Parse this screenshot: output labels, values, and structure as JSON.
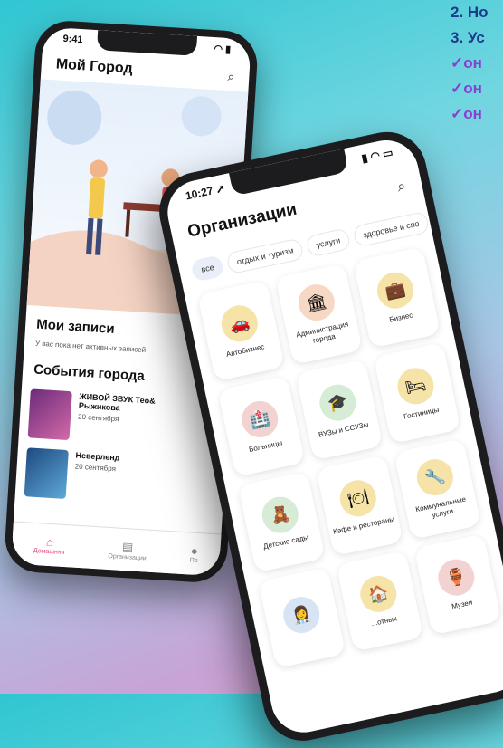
{
  "bullets": {
    "lines": [
      "2. Но",
      "3. Ус",
      "✓он",
      "✓он",
      "✓он"
    ]
  },
  "phone_back": {
    "time": "9:41",
    "title": "Мой Город",
    "records_title": "Мои записи",
    "records_empty": "У вас пока нет активных записей",
    "events_title": "События города",
    "events": [
      {
        "title": "ЖИВОЙ ЗВУК Тео& Рыжикова",
        "date": "20 сентября",
        "thumb": "#6b2b7a"
      },
      {
        "title": "Неверленд",
        "date": "20 сентября",
        "thumb": "#2a6aa8"
      }
    ],
    "tabs": [
      {
        "label": "Домашняя",
        "icon": "home-icon",
        "glyph": "⌂"
      },
      {
        "label": "Организации",
        "icon": "organizations-icon",
        "glyph": "▤"
      },
      {
        "label": "Пр",
        "icon": "profile-icon",
        "glyph": "●"
      }
    ]
  },
  "phone_front": {
    "time": "10:27",
    "title": "Организации",
    "chips": [
      "все",
      "отдых и туризм",
      "услуги",
      "здоровье и спо"
    ],
    "categories": [
      {
        "label": "Автобизнес",
        "icon": "car-icon",
        "glyph": "🚗",
        "color": "#f6e3a8"
      },
      {
        "label": "Администрация города",
        "icon": "city-hall-icon",
        "glyph": "🏛",
        "color": "#f7d8c4"
      },
      {
        "label": "Бизнес",
        "icon": "briefcase-icon",
        "glyph": "💼",
        "color": "#f6e3a8"
      },
      {
        "label": "Больницы",
        "icon": "hospital-icon",
        "glyph": "🏥",
        "color": "#f3d2d2"
      },
      {
        "label": "ВУЗы и ССУЗы",
        "icon": "education-icon",
        "glyph": "🎓",
        "color": "#d6ecd6"
      },
      {
        "label": "Гостиницы",
        "icon": "hotel-icon",
        "glyph": "🛏",
        "color": "#f6e3a8"
      },
      {
        "label": "Детские сады",
        "icon": "kindergarten-icon",
        "glyph": "🧸",
        "color": "#d6ecd6"
      },
      {
        "label": "Кафе и рестораны",
        "icon": "cafe-icon",
        "glyph": "🍽",
        "color": "#f6e3a8"
      },
      {
        "label": "Коммунальные услуги",
        "icon": "utilities-icon",
        "glyph": "🔧",
        "color": "#f6e3a8"
      },
      {
        "label": "",
        "icon": "doctor-icon",
        "glyph": "👩‍⚕️",
        "color": "#d6e4f3"
      },
      {
        "label": "...отных",
        "icon": "shelter-icon",
        "glyph": "🏠",
        "color": "#f6e3a8"
      },
      {
        "label": "Музеи",
        "icon": "museum-icon",
        "glyph": "🏺",
        "color": "#f3d2d2"
      }
    ]
  }
}
